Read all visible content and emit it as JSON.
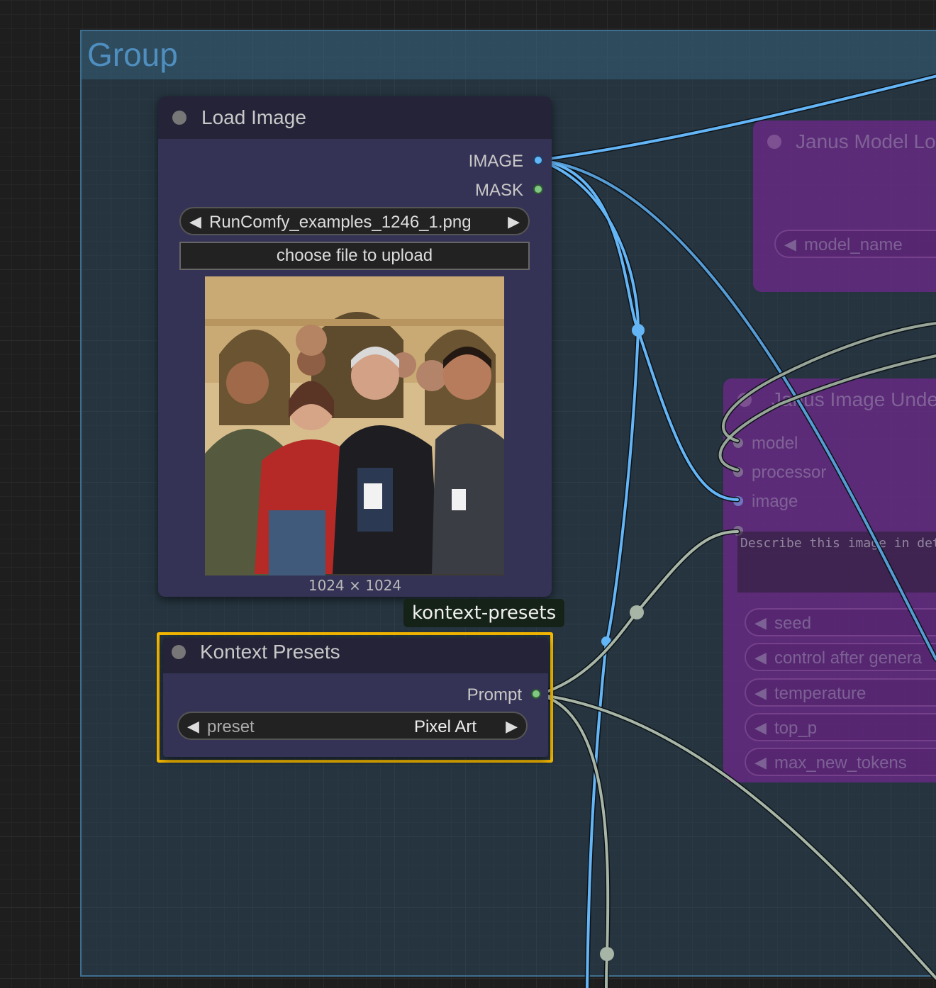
{
  "group": {
    "title": "Group"
  },
  "load_image_node": {
    "title": "Load Image",
    "outputs": {
      "image": "IMAGE",
      "mask": "MASK"
    },
    "image_combo": {
      "value": "RunComfy_examples_1246_1.png"
    },
    "upload_button": "choose file to upload",
    "image_size": "1024 × 1024"
  },
  "badge": {
    "label": "kontext-presets"
  },
  "kontext_presets_node": {
    "title": "Kontext Presets",
    "output": "Prompt",
    "preset_combo": {
      "label": "preset",
      "value": "Pixel Art"
    }
  },
  "janus_model_loader": {
    "title": "Janus Model Lo",
    "widget": "model_name"
  },
  "janus_understanding": {
    "title": "Janus Image Unde",
    "inputs": [
      "model",
      "processor",
      "image"
    ],
    "prompt_text": "Describe this image in deta",
    "widgets": [
      "seed",
      "control after genera",
      "temperature",
      "top_p",
      "max_new_tokens"
    ]
  },
  "colors": {
    "accent_selected": "#f5b800",
    "image_wire": "#64b5f6",
    "string_wire": "#a6b5a6",
    "mask_slot": "#81c784",
    "node_body": "#353355",
    "node_header": "#242338",
    "group_fill": "#30546e"
  },
  "photo": {
    "scene": "group of smiling people with lanyards in front of an arched stone building"
  }
}
